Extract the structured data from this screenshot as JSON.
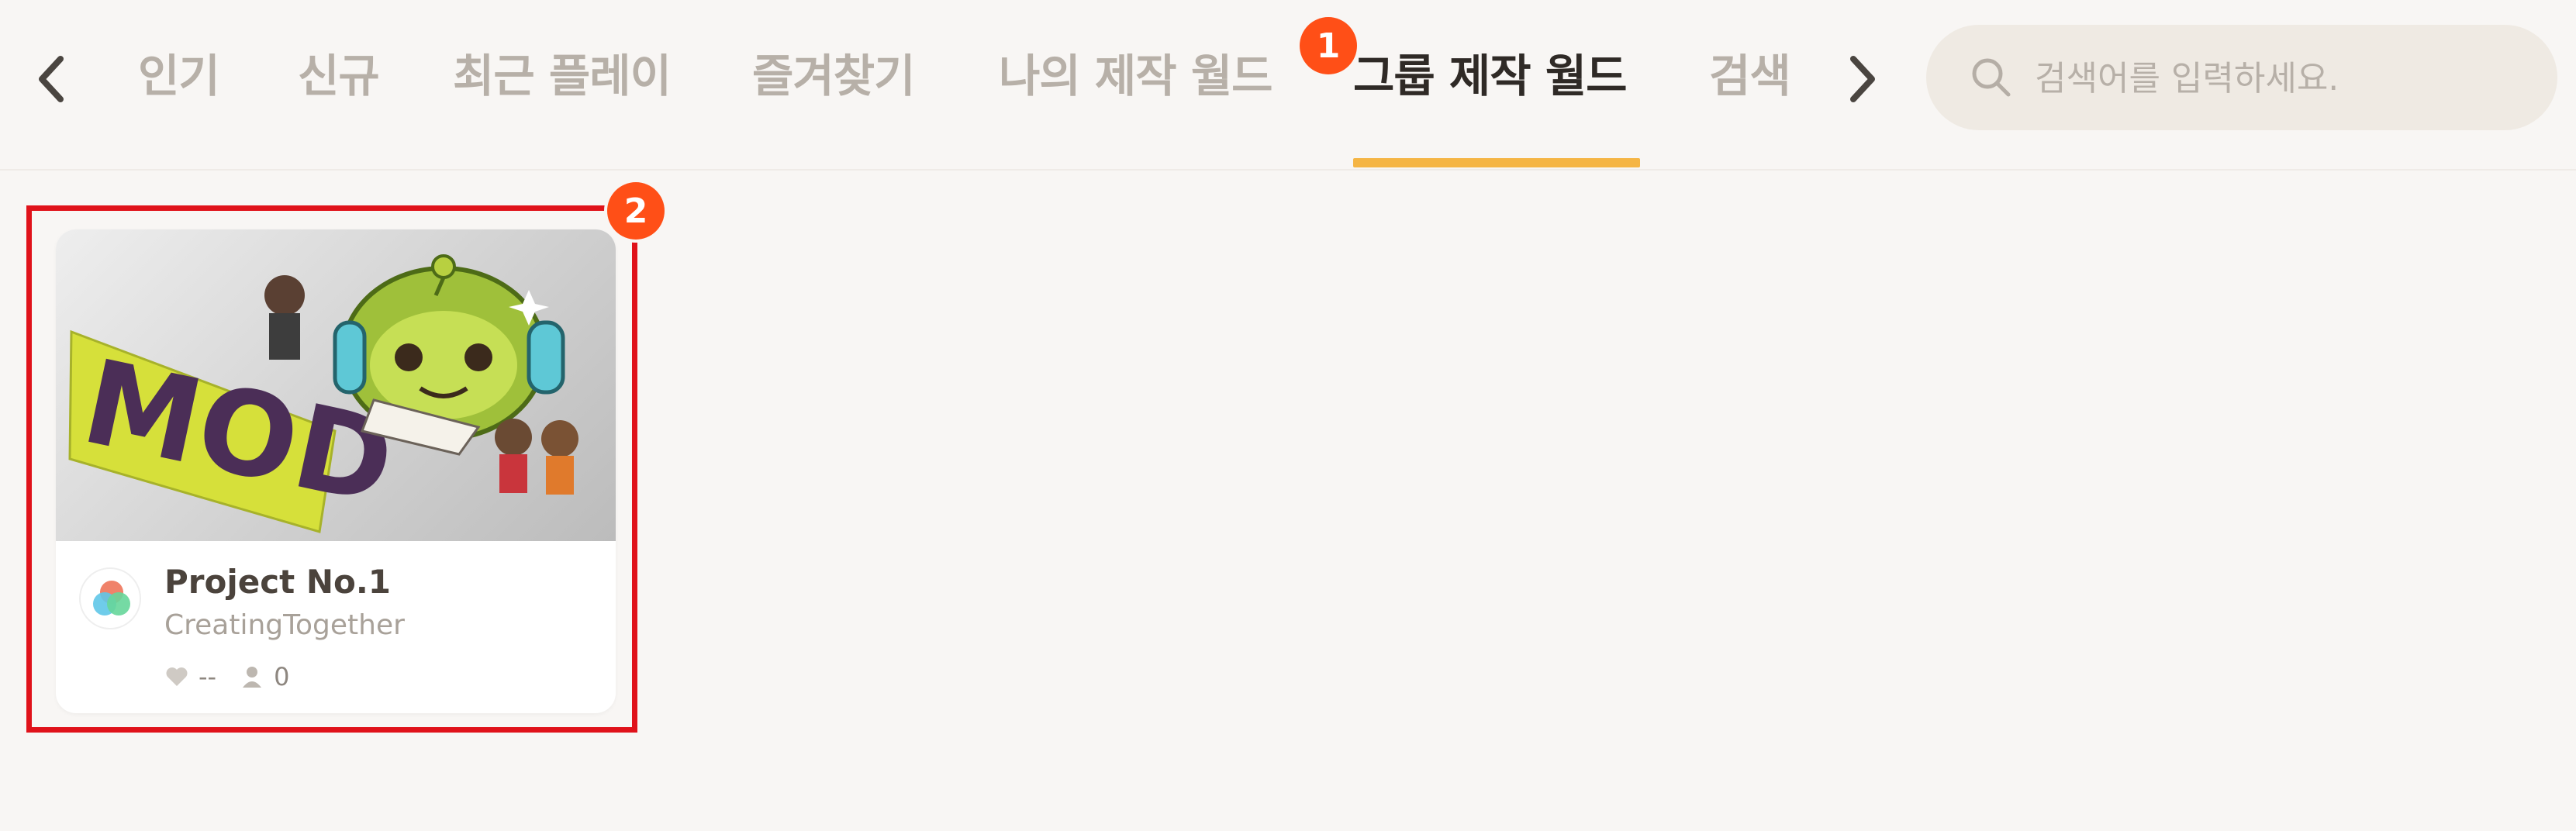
{
  "nav": {
    "prev_icon": "chevron-left-icon",
    "next_icon": "chevron-right-icon",
    "tabs": [
      {
        "label": "인기"
      },
      {
        "label": "신규"
      },
      {
        "label": "최근 플레이"
      },
      {
        "label": "즐겨찾기"
      },
      {
        "label": "나의 제작 월드"
      },
      {
        "label": "그룹 제작 월드",
        "active": true
      },
      {
        "label": "검색"
      }
    ],
    "accent_color": "#f5b544"
  },
  "search": {
    "placeholder": "검색어를 입력하세요.",
    "value": "",
    "icon": "search-icon"
  },
  "annotations": [
    {
      "number": "1",
      "color": "#ff4f17"
    },
    {
      "number": "2",
      "color": "#ff4f17"
    }
  ],
  "highlight_color": "#e0121a",
  "world_card": {
    "thumbnail_text": "MOD",
    "title": "Project No.1",
    "group": "CreatingTogether",
    "likes": "--",
    "players": "0",
    "like_icon": "heart-icon",
    "player_icon": "person-icon"
  }
}
